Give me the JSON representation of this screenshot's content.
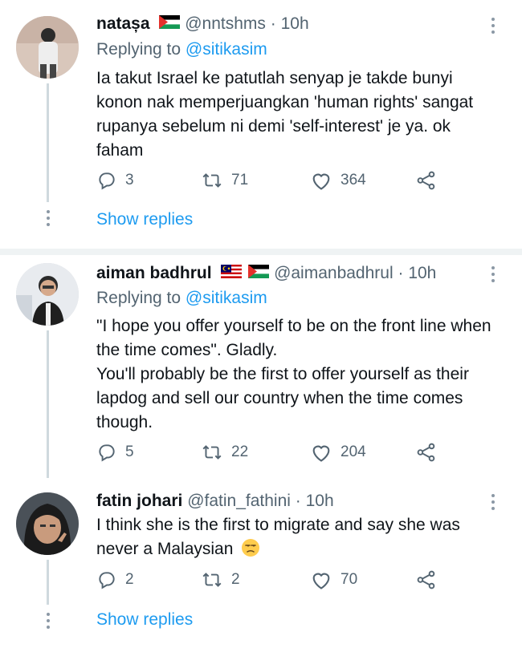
{
  "tweets": [
    {
      "name": "natașa",
      "handle": "@nntshms",
      "separator": "·",
      "time": "10h",
      "replying_label": "Replying to",
      "replying_to": "@sitikasim",
      "text_lines": [
        "Ia takut Israel ke patutlah senyap je takde bunyi",
        "konon nak memperjuangkan 'human rights' sangat",
        "rupanya sebelum ni demi 'self-interest' je ya. ok",
        "faham"
      ],
      "replies": "3",
      "retweets": "71",
      "likes": "364",
      "show_replies": "Show replies"
    },
    {
      "name": "aiman badhrul",
      "handle": "@aimanbadhrul",
      "separator": "·",
      "time": "10h",
      "replying_label": "Replying to",
      "replying_to": "@sitikasim",
      "text_lines": [
        "\"I hope you offer yourself to be on the front line when",
        "the time comes\". Gladly.",
        "You'll probably be the first to offer yourself as their",
        "lapdog and sell our country when the time comes",
        "though."
      ],
      "replies": "5",
      "retweets": "22",
      "likes": "204"
    },
    {
      "name": "fatin johari",
      "handle": "@fatin_fathini",
      "separator": "·",
      "time": "10h",
      "text_lines": [
        "I think she is the first to migrate and say she was",
        "never a Malaysian"
      ],
      "emoji": "unamused-face-emoji",
      "replies": "2",
      "retweets": "2",
      "likes": "70",
      "show_replies": "Show replies"
    }
  ],
  "colors": {
    "link": "#1d9bf0",
    "secondary": "#536471",
    "divider": "#eff3f4"
  },
  "icons": [
    "reply-icon",
    "retweet-icon",
    "like-icon",
    "share-icon",
    "more-options-icon",
    "palestine-flag-icon",
    "malaysia-flag-icon"
  ]
}
